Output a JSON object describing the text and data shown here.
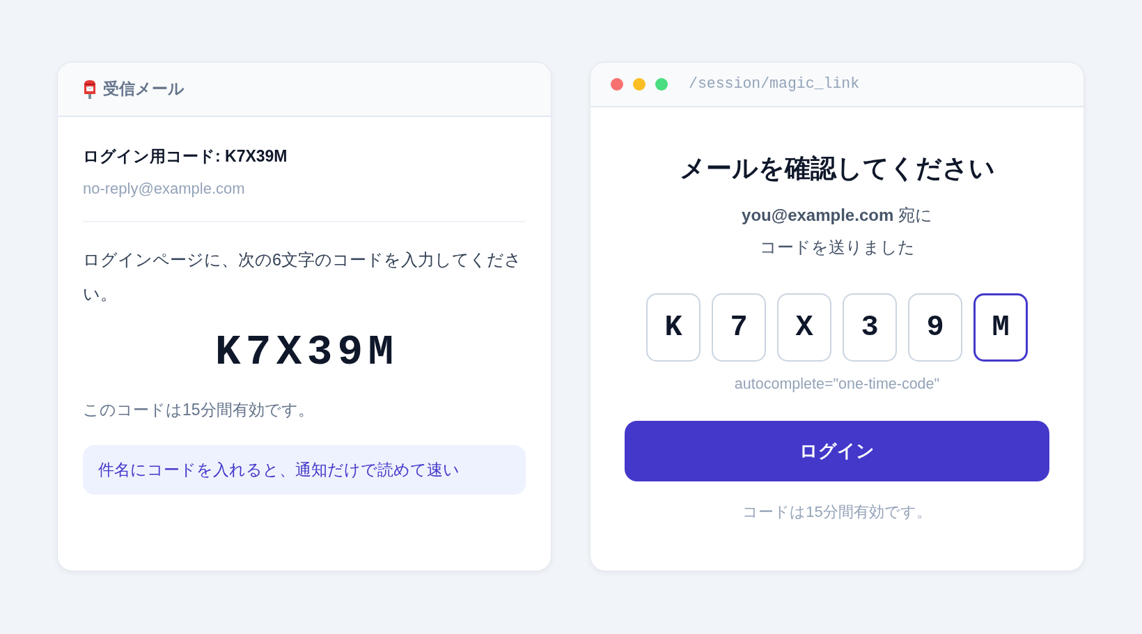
{
  "inbox": {
    "title": "受信メール",
    "email": {
      "subject": "ログイン用コード: K7X39M",
      "sender": "no-reply@example.com",
      "body": "ログインページに、次の6文字のコードを入力してください。",
      "code": "K7X39M",
      "validity": "このコードは15分間有効です。",
      "tip": "件名にコードを入れると、通知だけで読めて速い"
    }
  },
  "browser": {
    "window_controls": [
      {
        "color": "#f87171"
      },
      {
        "color": "#fbbf24"
      },
      {
        "color": "#4ade80"
      }
    ],
    "path": "/session/magic_link",
    "heading": "メールを確認してください",
    "sent_to": "**you@example.com** 宛にコードを送りました",
    "otp": [
      {
        "value": "K",
        "selected": false
      },
      {
        "value": "7",
        "selected": false
      },
      {
        "value": "X",
        "selected": false
      },
      {
        "value": "3",
        "selected": false
      },
      {
        "value": "9",
        "selected": false
      },
      {
        "value": "M",
        "selected": true
      }
    ],
    "hint": "autocomplete=\"one-time-code\"",
    "button": "ログイン",
    "footer": "コードは15分間有効です。"
  }
}
